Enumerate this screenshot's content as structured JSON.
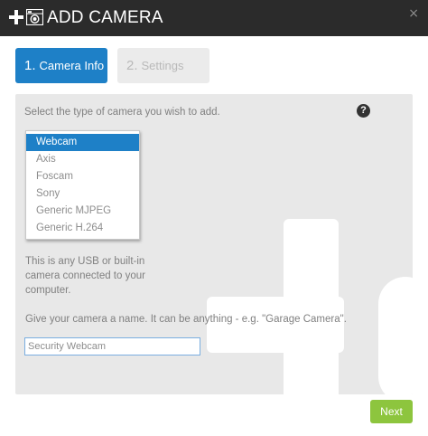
{
  "window": {
    "title": "ADD CAMERA",
    "close_label": "×",
    "title_icons": [
      "plus-icon",
      "camera-icon"
    ]
  },
  "steps": [
    {
      "number": "1.",
      "label": "Camera Info",
      "active": true
    },
    {
      "number": "2.",
      "label": "Settings",
      "active": false
    }
  ],
  "form": {
    "instruction": "Select the type of camera you wish to add.",
    "help_label": "?",
    "camera_types": [
      "Webcam",
      "Axis",
      "Foscam",
      "Sony",
      "Generic MJPEG",
      "Generic H.264"
    ],
    "selected_camera_type": "Webcam",
    "type_description": "This is any USB or built-in camera connected to your computer.",
    "name_hint": "Give your camera a name. It can be anything - e.g. \"Garage Camera\".",
    "name_value": "Security Webcam"
  },
  "footer": {
    "next_label": "Next"
  },
  "colors": {
    "titlebar": "#2b2b2b",
    "accent_blue": "#1e80c7",
    "next_green": "#8dc53e",
    "panel_bg": "#e8e8e8"
  }
}
